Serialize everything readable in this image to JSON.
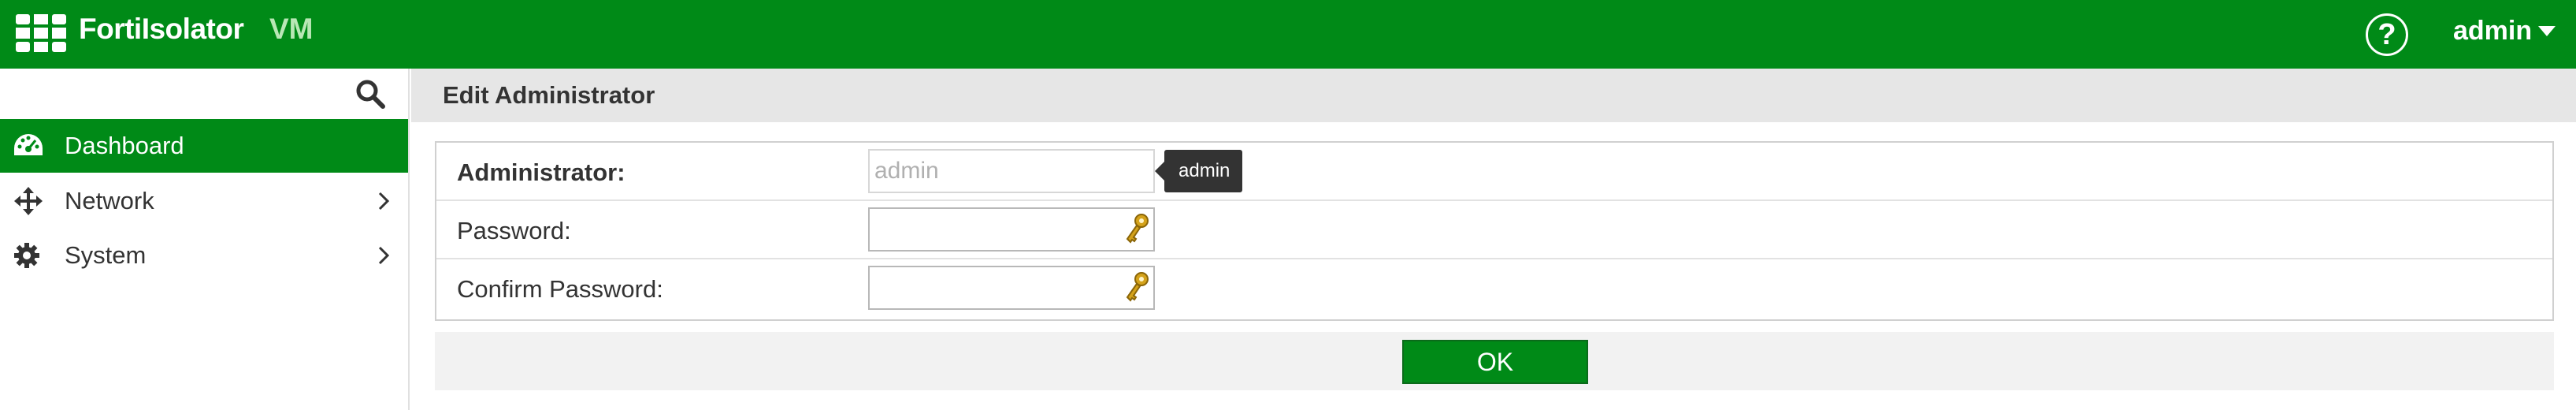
{
  "header": {
    "app_name": "FortiIsolator",
    "app_edition": "VM",
    "help_symbol": "?",
    "user_label": "admin",
    "logo_icon": "fortinet-logo-icon",
    "help_icon": "help-icon",
    "user_caret_icon": "caret-down-icon"
  },
  "sidebar": {
    "search_icon": "search-icon",
    "items": [
      {
        "label": "Dashboard",
        "icon": "dashboard-icon",
        "active": true
      },
      {
        "label": "Network",
        "icon": "move-arrows-icon",
        "has_children": true
      },
      {
        "label": "System",
        "icon": "gear-icon",
        "has_children": true
      }
    ]
  },
  "main": {
    "title": "Edit Administrator",
    "form": {
      "administrator": {
        "label": "Administrator:",
        "value": "admin",
        "tooltip": "admin"
      },
      "password": {
        "label": "Password:",
        "value": "",
        "icon": "key-icon"
      },
      "confirm_password": {
        "label": "Confirm Password:",
        "value": "",
        "icon": "key-icon"
      }
    },
    "ok_label": "OK"
  },
  "colors": {
    "brand_green": "#008a17",
    "edition_green": "#b9e7b6",
    "tooltip_bg": "#333333",
    "header_gray": "#e6e6e6"
  }
}
